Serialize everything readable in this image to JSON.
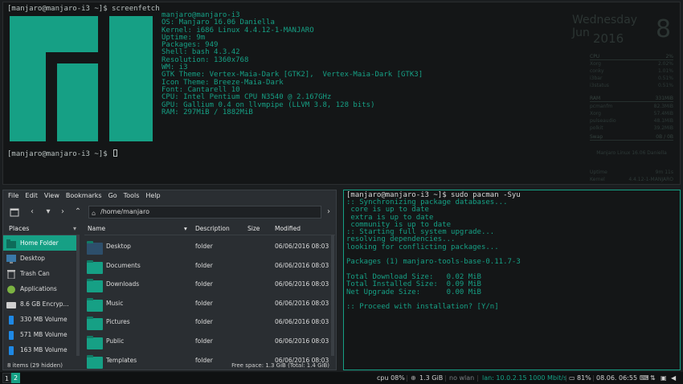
{
  "top_terminal": {
    "prompt_command": "[manjaro@manjaro-i3 ~]$ screenfetch",
    "prompt_idle": "[manjaro@manjaro-i3 ~]$ ",
    "sysinfo": [
      "manjaro@manjaro-i3",
      "OS: Manjaro 16.06 Daniella",
      "Kernel: i686 Linux 4.4.12-1-MANJARO",
      "Uptime: 9m",
      "Packages: 949",
      "Shell: bash 4.3.42",
      "Resolution: 1360x768",
      "WM: i3",
      "GTK Theme: Vertex-Maia-Dark [GTK2],  Vertex-Maia-Dark [GTK3]",
      "Icon Theme: Breeze-Maia-Dark",
      "Font: Cantarell 10",
      "CPU: Intel Pentium CPU N3540 @ 2.167GHz",
      "GPU: Gallium 0.4 on llvmpipe (LLVM 3.8, 128 bits)",
      "RAM: 297MiB / 1882MiB"
    ]
  },
  "conky": {
    "day": "Wednesday",
    "month": "Jun",
    "year": "2016",
    "daynum": "8",
    "cpu_label": "CPU",
    "cpu_value": "2%",
    "procs": [
      {
        "name": "Xorg",
        "val": "2.02%"
      },
      {
        "name": "conky",
        "val": "1.01%"
      },
      {
        "name": "i3bar",
        "val": "0.51%"
      },
      {
        "name": "i3status",
        "val": "0.51%"
      }
    ],
    "ram_label": "RAM",
    "ram_value": "331MiB",
    "mems": [
      {
        "name": "pcmanfm",
        "val": "82.3MiB"
      },
      {
        "name": "Xorg",
        "val": "57.4MiB"
      },
      {
        "name": "pulseaudio",
        "val": "48.1MiB"
      },
      {
        "name": "polkit",
        "val": "39.2MiB"
      }
    ],
    "swap_label": "Swap",
    "swap_value": "0B / 0B",
    "distro": "Manjaro Linux 16.06 Daniella",
    "footer": [
      {
        "name": "Uptime",
        "val": "9m 11s"
      },
      {
        "name": "Kernel",
        "val": "4.4.12-1-MANJARO"
      }
    ]
  },
  "file_manager": {
    "menu": [
      "File",
      "Edit",
      "View",
      "Bookmarks",
      "Go",
      "Tools",
      "Help"
    ],
    "location": "/home/manjaro",
    "places_header": "Places",
    "places": [
      {
        "label": "Home Folder",
        "icon": "home-folder-icon"
      },
      {
        "label": "Desktop",
        "icon": "desktop-icon"
      },
      {
        "label": "Trash Can",
        "icon": "trash-icon"
      },
      {
        "label": "Applications",
        "icon": "applications-icon"
      },
      {
        "label": "8.6 GB Encryp...",
        "icon": "drive-icon"
      },
      {
        "label": "330 MB Volume",
        "icon": "usb-drive-icon"
      },
      {
        "label": "571 MB Volume",
        "icon": "usb-drive-icon"
      },
      {
        "label": "163 MB Volume",
        "icon": "usb-drive-icon"
      }
    ],
    "columns": {
      "name": "Name",
      "description": "Description",
      "size": "Size",
      "modified": "Modified"
    },
    "files": [
      {
        "name": "Desktop",
        "description": "folder",
        "size": "",
        "modified": "06/06/2016 08:03"
      },
      {
        "name": "Documents",
        "description": "folder",
        "size": "",
        "modified": "06/06/2016 08:03"
      },
      {
        "name": "Downloads",
        "description": "folder",
        "size": "",
        "modified": "06/06/2016 08:03"
      },
      {
        "name": "Music",
        "description": "folder",
        "size": "",
        "modified": "06/06/2016 08:03"
      },
      {
        "name": "Pictures",
        "description": "folder",
        "size": "",
        "modified": "06/06/2016 08:03"
      },
      {
        "name": "Public",
        "description": "folder",
        "size": "",
        "modified": "06/06/2016 08:03"
      },
      {
        "name": "Templates",
        "description": "folder",
        "size": "",
        "modified": "06/06/2016 08:03"
      }
    ],
    "status_left": "8 items (29 hidden)",
    "status_right": "Free space: 1.3 GiB (Total: 1.4 GiB)"
  },
  "pacman_terminal": {
    "prompt": "[manjaro@manjaro-i3 ~]$ sudo pacman -Syu",
    "output": [
      ":: Synchronizing package databases...",
      " core is up to date",
      " extra is up to date",
      " community is up to date",
      ":: Starting full system upgrade...",
      "resolving dependencies...",
      "looking for conflicting packages...",
      "",
      "Packages (1) manjaro-tools-base-0.11.7-3",
      "",
      "Total Download Size:   0.02 MiB",
      "Total Installed Size:  0.09 MiB",
      "Net Upgrade Size:      0.00 MiB",
      "",
      ":: Proceed with installation? [Y/n]"
    ]
  },
  "statusbar": {
    "ws1": "1",
    "ws2": "2",
    "cpu": "cpu  08%",
    "mem": "1.3 GiB",
    "wlan": "no wlan",
    "lan": "lan: 10.0.2.15 1000 Mbit/s",
    "battery": "81%",
    "datetime": "08.06. 06:55"
  },
  "colors": {
    "accent": "#16a085",
    "background": "#1b1e20",
    "terminal_bg": "#141617"
  }
}
